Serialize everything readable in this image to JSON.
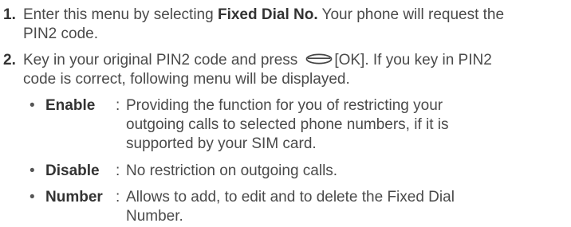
{
  "steps": [
    {
      "number": "1.",
      "line1_pre": "Enter this menu by selecting ",
      "line1_bold": "Fixed Dial No.",
      "line1_post": " Your phone will request the",
      "line2": "PIN2 code."
    },
    {
      "number": "2.",
      "line1_pre": "Key in your original PIN2 code and press",
      "key_icon": "ok-soft-key-icon",
      "line1_post": "[OK]. If you key in PIN2",
      "line2": "code is correct, following menu will be displayed."
    }
  ],
  "options": [
    {
      "bullet": "•",
      "term": "Enable",
      "colon": ":",
      "lines": [
        "Providing the function for you of restricting your",
        "outgoing calls to selected phone numbers, if it is",
        "supported by your SIM card."
      ]
    },
    {
      "bullet": "•",
      "term": "Disable",
      "colon": ":",
      "lines": [
        "No restriction on outgoing calls."
      ]
    },
    {
      "bullet": "•",
      "term": "Number",
      "colon": ":",
      "lines": [
        "Allows to add, to edit and to delete the Fixed Dial",
        "Number."
      ]
    }
  ],
  "colors": {
    "text": "#4a4a4a",
    "heading": "#333333"
  }
}
